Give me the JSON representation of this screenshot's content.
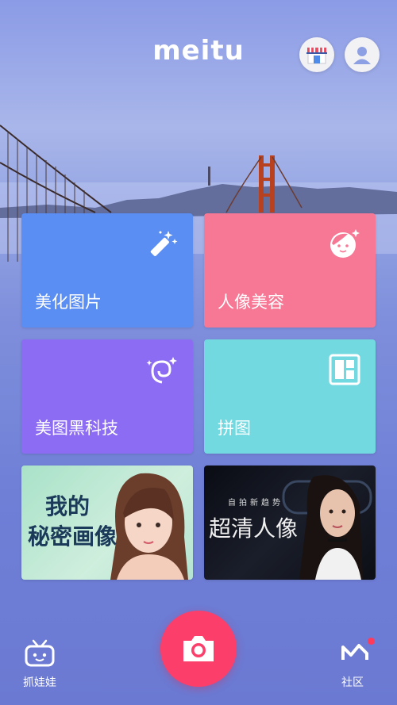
{
  "header": {
    "logo_text": "meitu",
    "store_icon": "store-awning-icon",
    "user_icon": "user-avatar-icon"
  },
  "tiles": [
    {
      "label": "美化图片",
      "icon": "magic-wand-icon",
      "color": "#5a8ef2"
    },
    {
      "label": "人像美容",
      "icon": "face-sparkle-icon",
      "color": "#f77895"
    },
    {
      "label": "美图黑科技",
      "icon": "hair-sparkle-icon",
      "color": "#8c6cf2"
    },
    {
      "label": "拼图",
      "icon": "collage-grid-icon",
      "color": "#72d9e0"
    }
  ],
  "banners": [
    {
      "line1": "我的",
      "line2": "秘密画像"
    },
    {
      "tagline": "自拍新趋势",
      "headline": "超清人像"
    }
  ],
  "bottom_bar": {
    "left_label": "抓娃娃",
    "left_icon": "tv-robot-icon",
    "camera_icon": "camera-icon",
    "right_label": "社区",
    "right_icon": "meitu-m-icon",
    "accent_color": "#fb3f6a"
  }
}
